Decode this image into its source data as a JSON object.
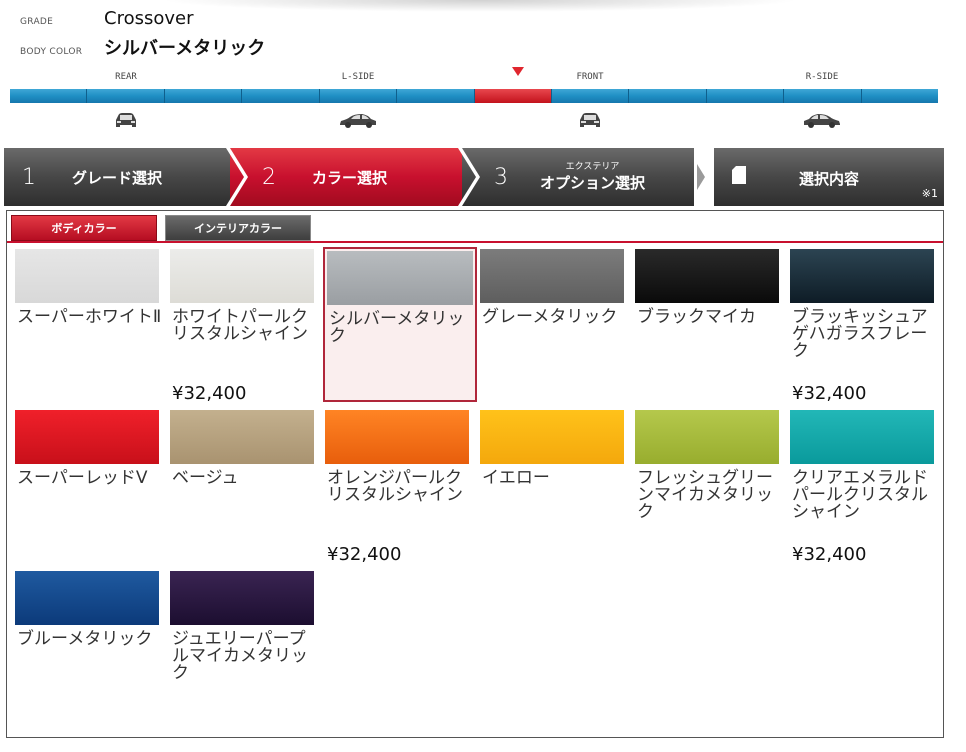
{
  "info": {
    "grade_key": "GRADE",
    "grade_val": "Crossover",
    "body_key": "BODY COLOR",
    "body_val": "シルバーメタリック"
  },
  "views": {
    "labels": [
      "REAR",
      "L-SIDE",
      "FRONT",
      "R-SIDE"
    ],
    "active_segment": 6,
    "segment_count": 12
  },
  "steps": [
    {
      "num": "1",
      "label": "グレード選択",
      "state": "done"
    },
    {
      "num": "2",
      "label": "カラー選択",
      "state": "active"
    },
    {
      "num": "3",
      "small": "エクステリア",
      "label": "オプション選択",
      "state": "todo"
    }
  ],
  "summary": {
    "label": "選択内容",
    "note": "※1"
  },
  "tabs": [
    {
      "label": "ボディカラー",
      "active": true
    },
    {
      "label": "インテリアカラー",
      "active": false
    }
  ],
  "colors": [
    {
      "name": "スーパーホワイトⅡ",
      "price": "",
      "color": "#e6e6e6",
      "color2": "#d8d8d8"
    },
    {
      "name": "ホワイトパールクリスタルシャイン",
      "price": "¥32,400",
      "color": "#ececea",
      "color2": "#dddcd6"
    },
    {
      "name": "シルバーメタリック",
      "price": "",
      "color": "#b8bcbf",
      "color2": "#9a9ea2",
      "selected": true
    },
    {
      "name": "グレーメタリック",
      "price": "",
      "color": "#7c7c7c",
      "color2": "#5e5e5e"
    },
    {
      "name": "ブラックマイカ",
      "price": "",
      "color": "#2a2a2a",
      "color2": "#0a0a0a"
    },
    {
      "name": "ブラッキッシュアゲハガラスフレーク",
      "price": "¥32,400",
      "color": "#2c4452",
      "color2": "#0e1c26"
    },
    {
      "name": "スーパーレッドⅤ",
      "price": "",
      "color": "#f0202a",
      "color2": "#c8101a"
    },
    {
      "name": "ベージュ",
      "price": "",
      "color": "#c3b08e",
      "color2": "#a99370"
    },
    {
      "name": "オレンジパールクリスタルシャイン",
      "price": "¥32,400",
      "color": "#ff8424",
      "color2": "#e85e0c"
    },
    {
      "name": "イエロー",
      "price": "",
      "color": "#ffc21a",
      "color2": "#f4a80c"
    },
    {
      "name": "フレッシュグリーンマイカメタリック",
      "price": "",
      "color": "#b5c84c",
      "color2": "#98ad2e"
    },
    {
      "name": "クリアエメラルドパールクリスタルシャイン",
      "price": "¥32,400",
      "color": "#22b7b7",
      "color2": "#0a9a9c"
    },
    {
      "name": "ブルーメタリック",
      "price": "",
      "color": "#1f5aa0",
      "color2": "#0c3a7a"
    },
    {
      "name": "ジュエリーパープルマイカメタリック",
      "price": "",
      "color": "#3a2452",
      "color2": "#1c0e30"
    }
  ],
  "colors_accent": {
    "red": "#c8102e",
    "blue": "#1f8fc4"
  }
}
